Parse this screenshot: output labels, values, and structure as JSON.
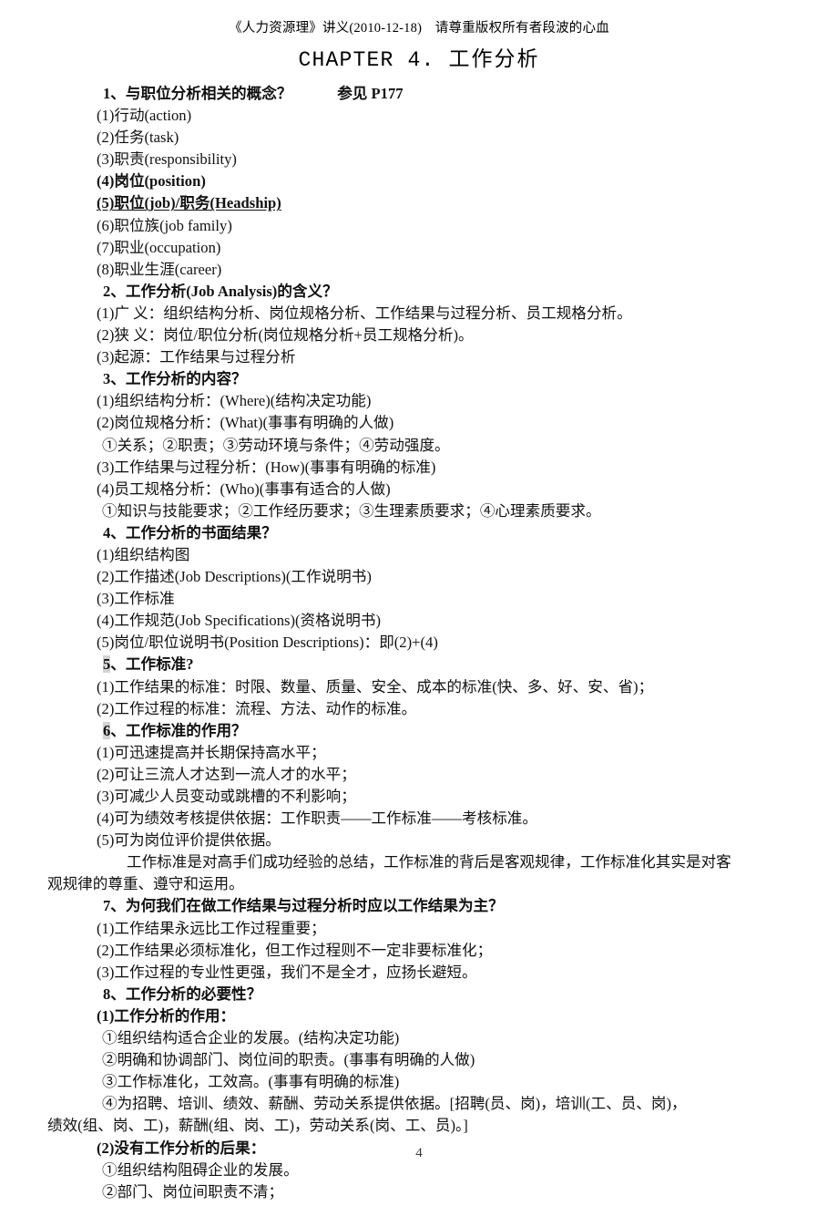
{
  "header": {
    "running_head": "《人力资源理》讲义(2010-12-18)　请尊重版权所有者段波的心血",
    "chapter_title_latin": "CHAPTER 4.",
    "chapter_title_cn": "工作分析"
  },
  "sections": [
    {
      "heading": "1、与职位分析相关的概念？　　　参见 P177",
      "lines": [
        {
          "text": "(1)行动(action)",
          "style": "item"
        },
        {
          "text": "(2)任务(task)",
          "style": "item"
        },
        {
          "text": "(3)职责(responsibility)",
          "style": "item"
        },
        {
          "text": "(4)岗位(position)",
          "style": "item-bold"
        },
        {
          "text": "(5)职位(job)/职务(Headship)",
          "style": "item-bold-underline"
        },
        {
          "text": "(6)职位族(job family)",
          "style": "item"
        },
        {
          "text": "(7)职业(occupation)",
          "style": "item"
        },
        {
          "text": "(8)职业生涯(career)",
          "style": "item"
        }
      ]
    },
    {
      "heading": "2、工作分析(Job Analysis)的含义？",
      "lines": [
        {
          "text": "(1)广 义：组织结构分析、岗位规格分析、工作结果与过程分析、员工规格分析。",
          "style": "item"
        },
        {
          "text": "(2)狭 义：岗位/职位分析(岗位规格分析+员工规格分析)。",
          "style": "item"
        },
        {
          "text": "(3)起源：工作结果与过程分析",
          "style": "item"
        }
      ]
    },
    {
      "heading": "3、工作分析的内容？",
      "lines": [
        {
          "text": "(1)组织结构分析：(Where)(结构决定功能)",
          "style": "item"
        },
        {
          "text": "(2)岗位规格分析：(What)(事事有明确的人做)",
          "style": "item"
        },
        {
          "text": "①关系；②职责；③劳动环境与条件；④劳动强度。",
          "style": "sub"
        },
        {
          "text": "(3)工作结果与过程分析：(How)(事事有明确的标准)",
          "style": "item"
        },
        {
          "text": "(4)员工规格分析：(Who)(事事有适合的人做)",
          "style": "item"
        },
        {
          "text": "①知识与技能要求；②工作经历要求；③生理素质要求；④心理素质要求。",
          "style": "sub"
        }
      ]
    },
    {
      "heading": "4、工作分析的书面结果？",
      "lines": [
        {
          "text": "(1)组织结构图",
          "style": "item"
        },
        {
          "text": "(2)工作描述(Job Descriptions)(工作说明书)",
          "style": "item"
        },
        {
          "text": "(3)工作标准",
          "style": "item"
        },
        {
          "text": "(4)工作规范(Job Specifications)(资格说明书)",
          "style": "item"
        },
        {
          "text": "(5)岗位/职位说明书(Position Descriptions)：即(2)+(4)",
          "style": "item"
        }
      ]
    },
    {
      "heading_number": "5",
      "heading_rest": "、工作标准?",
      "heading_highlight": true,
      "lines": [
        {
          "text": "(1)工作结果的标准：时限、数量、质量、安全、成本的标准(快、多、好、安、省)；",
          "style": "item"
        },
        {
          "text": "(2)工作过程的标准：流程、方法、动作的标准。",
          "style": "item"
        }
      ]
    },
    {
      "heading_number": "6",
      "heading_rest": "、工作标准的作用？",
      "heading_highlight": true,
      "lines": [
        {
          "text": "(1)可迅速提高并长期保持高水平；",
          "style": "item"
        },
        {
          "text": "(2)可让三流人才达到一流人才的水平；",
          "style": "item"
        },
        {
          "text": "(3)可减少人员变动或跳槽的不利影响；",
          "style": "item"
        },
        {
          "text": "(4)可为绩效考核提供依据：工作职责——工作标准——考核标准。",
          "style": "item"
        },
        {
          "text": "(5)可为岗位评价提供依据。",
          "style": "item"
        },
        {
          "text": "工作标准是对高手们成功经验的总结，工作标准的背后是客观规律，工作标准化其实是对客",
          "style": "para-first"
        },
        {
          "text": "观规律的尊重、遵守和运用。",
          "style": "flow"
        }
      ]
    },
    {
      "heading": "7、为何我们在做工作结果与过程分析时应以工作结果为主？",
      "lines": [
        {
          "text": "(1)工作结果永远比工作过程重要；",
          "style": "item"
        },
        {
          "text": "(2)工作结果必须标准化，但工作过程则不一定非要标准化；",
          "style": "item"
        },
        {
          "text": "(3)工作过程的专业性更强，我们不是全才，应扬长避短。",
          "style": "item"
        }
      ]
    },
    {
      "heading": "8、工作分析的必要性？",
      "lines": [
        {
          "text": "(1)工作分析的作用：",
          "style": "item-bold"
        },
        {
          "text": "①组织结构适合企业的发展。(结构决定功能)",
          "style": "sub"
        },
        {
          "text": "②明确和协调部门、岗位间的职责。(事事有明确的人做)",
          "style": "sub"
        },
        {
          "text": "③工作标准化，工效高。(事事有明确的标准)",
          "style": "sub"
        },
        {
          "text": "④为招聘、培训、绩效、薪酬、劳动关系提供依据。[招聘(员、岗)，培训(工、员、岗)，",
          "style": "sub-first"
        },
        {
          "text": "绩效(组、岗、工)，薪酬(组、岗、工)，劳动关系(岗、工、员)。]",
          "style": "flow"
        },
        {
          "text": "(2)没有工作分析的后果：",
          "style": "item-bold"
        },
        {
          "text": "①组织结构阻碍企业的发展。",
          "style": "sub"
        },
        {
          "text": "②部门、岗位间职责不清；",
          "style": "sub"
        }
      ]
    }
  ],
  "footer": {
    "page_number": "4"
  }
}
